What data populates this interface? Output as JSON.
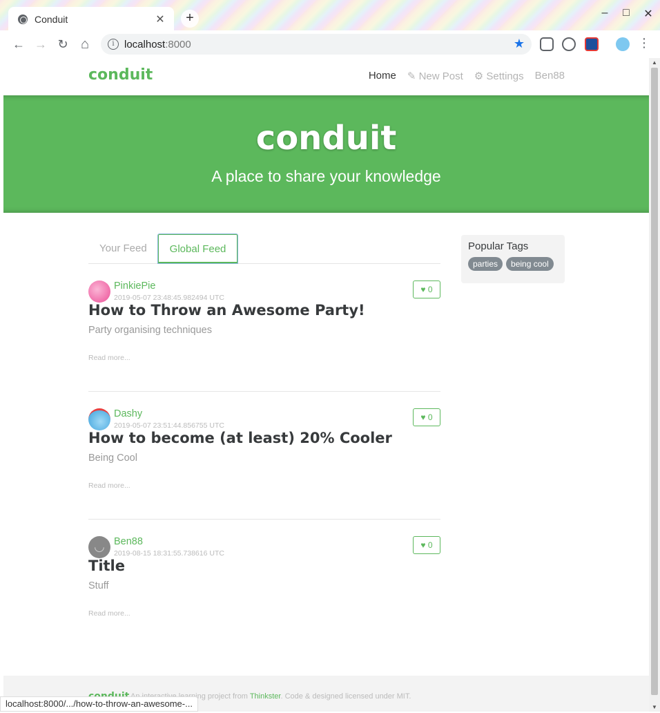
{
  "browser": {
    "tab_title": "Conduit",
    "tab_close": "✕",
    "new_tab": "+",
    "minimize": "–",
    "maximize": "□",
    "close": "✕",
    "back": "←",
    "forward": "→",
    "reload": "↻",
    "home": "⌂",
    "url_host": "localhost",
    "url_port": ":8000",
    "star": "★",
    "menu": "⋮",
    "status_url": "localhost:8000/.../how-to-throw-an-awesome-..."
  },
  "nav": {
    "brand": "conduit",
    "links": [
      {
        "label": "Home"
      },
      {
        "icon": "✎",
        "label": "New Post"
      },
      {
        "icon": "⚙",
        "label": "Settings"
      },
      {
        "label": "Ben88"
      }
    ]
  },
  "banner": {
    "title": "conduit",
    "subtitle": "A place to share your knowledge"
  },
  "feed": {
    "tabs": [
      "Your Feed",
      "Global Feed"
    ],
    "articles": [
      {
        "author": "PinkiePie",
        "date": "2019-05-07 23:48:45.982494 UTC",
        "likes": "0",
        "title": "How to Throw an Awesome Party!",
        "description": "Party organising techniques",
        "read_more": "Read more...",
        "avatar_color": "#f49ac1"
      },
      {
        "author": "Dashy",
        "date": "2019-05-07 23:51:44.856755 UTC",
        "likes": "0",
        "title": "How to become (at least) 20% Cooler",
        "description": "Being Cool",
        "read_more": "Read more...",
        "avatar_color": "#7ec8f0"
      },
      {
        "author": "Ben88",
        "date": "2019-08-15 18:31:55.738616 UTC",
        "likes": "0",
        "title": "Title",
        "description": "Stuff",
        "read_more": "Read more...",
        "avatar_color": "#888888"
      }
    ]
  },
  "sidebar": {
    "title": "Popular Tags",
    "tags": [
      "parties",
      "being cool"
    ]
  },
  "footer": {
    "brand": "conduit",
    "text_before": "An interactive learning project from ",
    "link": "Thinkster",
    "text_after": ". Code & designed licensed under MIT."
  },
  "colors": {
    "brand": "#5cb85c",
    "tag": "#818a91"
  }
}
